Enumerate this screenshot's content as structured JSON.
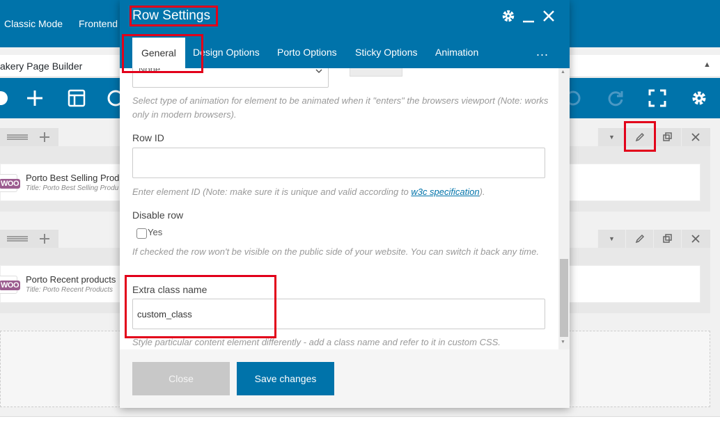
{
  "background": {
    "top_tabs": [
      "Classic Mode",
      "Frontend"
    ],
    "builder_title": "akery Page Builder",
    "rows": [
      {
        "element_name": "Porto Best Selling Prod",
        "element_subtitle": "Title: Porto Best Selling Produ"
      },
      {
        "element_name": "Porto Recent products",
        "element_subtitle": "Title: Porto Recent Products"
      }
    ],
    "woo_badge": "WOO"
  },
  "modal": {
    "title": "Row Settings",
    "tabs": [
      {
        "label": "General",
        "active": true
      },
      {
        "label": "Design Options",
        "active": false
      },
      {
        "label": "Porto Options",
        "active": false
      },
      {
        "label": "Sticky Options",
        "active": false
      },
      {
        "label": "Animation",
        "active": false
      }
    ],
    "more_label": "...",
    "animation_select_value": "None",
    "animation_help": "Select type of animation for element to be animated when it \"enters\" the browsers viewport (Note: works only in modern browsers).",
    "row_id": {
      "label": "Row ID",
      "value": "",
      "help_prefix": "Enter element ID (Note: make sure it is unique and valid according to ",
      "help_link": "w3c specification",
      "help_suffix": ")."
    },
    "disable_row": {
      "label": "Disable row",
      "checkbox_label": "Yes",
      "checked": false,
      "help": "If checked the row won't be visible on the public side of your website. You can switch it back any time."
    },
    "extra_class": {
      "label": "Extra class name",
      "value": "custom_class",
      "help": "Style particular content element differently - add a class name and refer to it in custom CSS."
    },
    "footer": {
      "close_label": "Close",
      "save_label": "Save changes"
    }
  },
  "colors": {
    "primary": "#0073aa",
    "highlight": "#e2001a",
    "woo": "#9b5c8f"
  }
}
